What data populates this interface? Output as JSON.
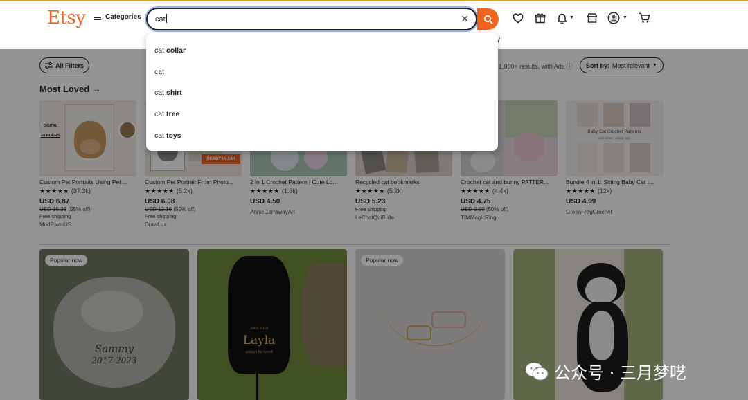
{
  "header": {
    "logo": "Etsy",
    "categories_label": "Categories",
    "search": {
      "value": "cat"
    },
    "stray_text": "y",
    "colors": {
      "brand": "#f1641e"
    }
  },
  "suggestions": [
    {
      "prefix": "cat",
      "suffix": "collar"
    },
    {
      "prefix": "cat",
      "suffix": ""
    },
    {
      "prefix": "cat",
      "suffix": "shirt"
    },
    {
      "prefix": "cat",
      "suffix": "tree"
    },
    {
      "prefix": "cat",
      "suffix": "toys"
    }
  ],
  "toolbar": {
    "all_filters_label": "All Filters",
    "results_text": "1,000+ results, with Ads ⓘ",
    "sort_prefix": "Sort by:",
    "sort_value": "Most relevant"
  },
  "section": {
    "title": "Most Loved →"
  },
  "products": [
    {
      "title": "Custom Pet Portraits Using Pet ...",
      "stars": "★★★★★",
      "reviews": "(37.3k)",
      "price": "USD 6.87",
      "original_price": "USD 15.26",
      "discount": "(55% off)",
      "shipping": "Free shipping",
      "shop": "ModPawsUS"
    },
    {
      "title": "Custom Pet Portrait From Photo...",
      "stars": "★★★★★",
      "reviews": "(5.2k)",
      "price": "USD 6.08",
      "original_price": "USD 12.16",
      "discount": "(50% off)",
      "shipping": "Free shipping",
      "shop": "DrawLux"
    },
    {
      "title": "2 in 1 Crochet Pattern | Cute Lo...",
      "stars": "★★★★★",
      "reviews": "(1.3k)",
      "price": "USD 4.50",
      "original_price": "",
      "discount": "",
      "shipping": "",
      "shop": "AnnieCarrawayArt"
    },
    {
      "title": "Recycled cat bookmarks",
      "stars": "★★★★★",
      "reviews": "(5.2k)",
      "price": "USD 5.23",
      "original_price": "",
      "discount": "",
      "shipping": "Free shipping",
      "shop": "LeChatQuiBulle"
    },
    {
      "title": "Crochet cat and bunny PATTER...",
      "stars": "★★★★★",
      "reviews": "(4.4k)",
      "price": "USD 4.75",
      "original_price": "USD 9.50",
      "discount": "(50% off)",
      "shipping": "",
      "shop": "TIMMagicRing"
    },
    {
      "title": "Bundle 4 in 1: Sitting Baby Cat I...",
      "stars": "★★★★★",
      "reviews": "(12k)",
      "price": "USD 4.99",
      "original_price": "",
      "discount": "",
      "shipping": "",
      "shop": "GreenFrogCrochet"
    }
  ],
  "product_image_text": {
    "p1_digital": "DIGITAL",
    "p1_time": "24 HOURS",
    "p2_ready": "READY IN 24H",
    "p6_title": "Baby Cat Crochet Patterns",
    "p6_sub": "cute ideas · sitting cats"
  },
  "big_cards": [
    {
      "badge": "Popular now",
      "name": "Sammy",
      "years": "2017-2023"
    },
    {
      "badge": "",
      "name": "Layla",
      "years": "2003-2018",
      "sub": "always be loved"
    },
    {
      "badge": "Popular now"
    },
    {
      "badge": ""
    }
  ],
  "watermark": "公众号 · 三月梦呓"
}
